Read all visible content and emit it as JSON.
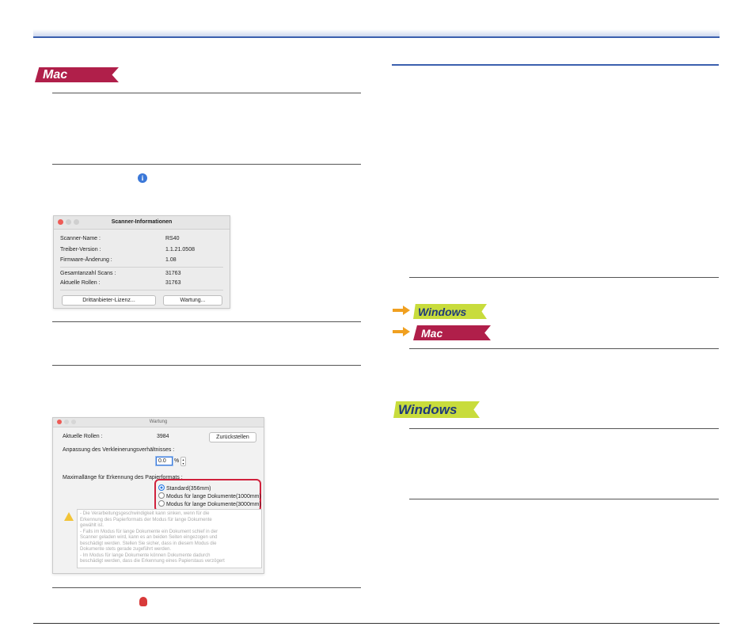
{
  "badges": {
    "mac": "Mac",
    "windows": "Windows"
  },
  "dialog_info": {
    "title": "Scanner-Informationen",
    "rows": [
      {
        "label": "Scanner-Name :",
        "value": "RS40"
      },
      {
        "label": "Treiber-Version :",
        "value": "1.1.21.0508"
      },
      {
        "label": "Firmware-Änderung :",
        "value": "1.08"
      },
      {
        "label": "Gesamtanzahl Scans :",
        "value": "31763"
      },
      {
        "label": "Aktuelle Rollen :",
        "value": "31763"
      }
    ],
    "license_button": "Drittanbieter-Lizenz...",
    "maintenance_button": "Wartung..."
  },
  "dialog_maint": {
    "title": "Wartung",
    "rollers_label": "Aktuelle Rollen :",
    "rollers_value": "3984",
    "reset_button": "Zurückstellen",
    "ratio_label": "Anpassung des Verkleinerungsverhältnisses :",
    "ratio_value": "0.0",
    "ratio_unit": "%",
    "maxlen_label": "Maximallänge für Erkennung des Papierformats :",
    "options": [
      {
        "label": "Standard(356mm)",
        "selected": true
      },
      {
        "label": "Modus für lange Dokumente(1000mm)",
        "selected": false
      },
      {
        "label": "Modus für lange Dokumente(3000mm)",
        "selected": false
      }
    ],
    "warning_lines": [
      "- Die Verarbeitungsgeschwindigkeit kann sinken, wenn für die",
      "Erkennung des Papierformats der Modus für lange Dokumente",
      "gewählt ist.",
      "- Falls im Modus für lange Dokumente ein Dokument schief in der",
      "Scanner geladen wird, kann es an beiden Seiten eingezogen und",
      "beschädigt werden. Stellen Sie sicher, dass in diesem Modus die",
      "Dokumente stets gerade zugeführt werden.",
      "- Im Modus für lange Dokumente können Dokumente dadurch",
      "beschädigt werden, dass die Erkennung eines Papierstaus verzögert"
    ]
  },
  "colors": {
    "header_bar": "#c9d3ec",
    "header_line": "#3b5fae",
    "mac_badge": "#b01f4a",
    "windows_badge": "#c8dc3c",
    "highlight": "#d0213c"
  }
}
